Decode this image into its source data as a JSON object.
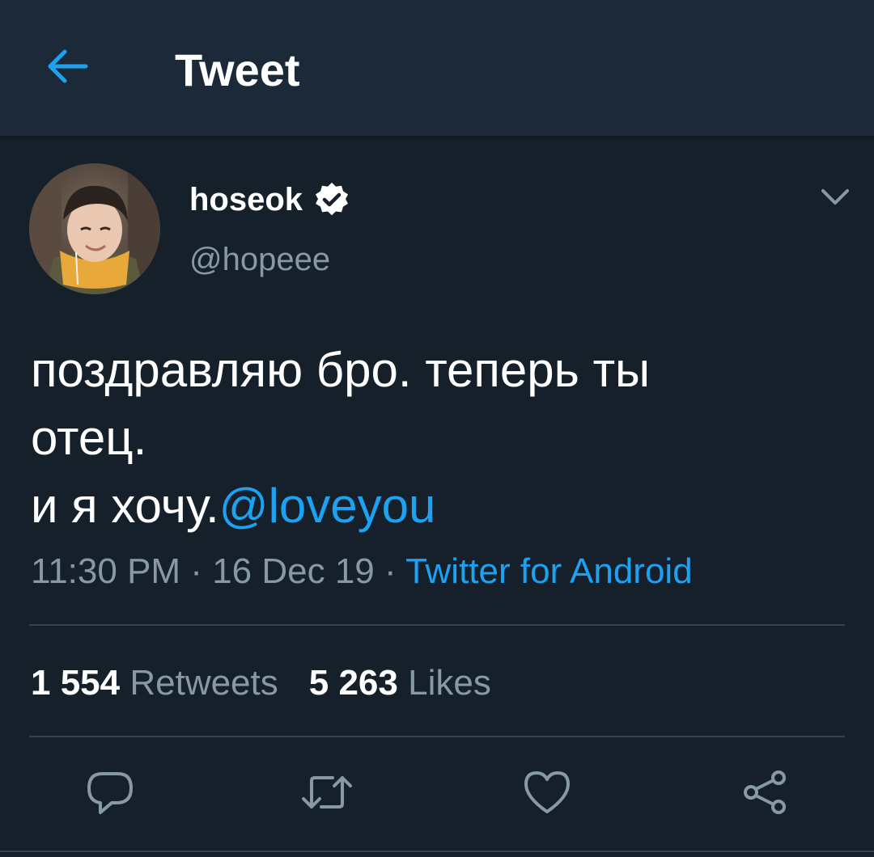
{
  "header": {
    "title": "Tweet"
  },
  "tweet": {
    "display_name": "hoseok",
    "handle": "@hopeee",
    "verified": true,
    "text_line1": "поздравляю бро. теперь ты",
    "text_line2": "отец.",
    "text_line3_plain": "и я хочу.",
    "text_line3_mention": "@loveyou",
    "time": "11:30 PM",
    "separator": " · ",
    "date": "16 Dec 19",
    "source": "Twitter for Android",
    "retweets_count": "1 554",
    "retweets_label": "Retweets",
    "likes_count": "5 263",
    "likes_label": "Likes"
  },
  "actions": {
    "icons": [
      "reply-icon",
      "retweet-icon",
      "like-icon",
      "share-icon"
    ]
  },
  "colors": {
    "background": "#15202b",
    "topbar": "#1c2938",
    "accent": "#1da1f2",
    "secondary_text": "#8899a6",
    "divider": "#38444d"
  }
}
